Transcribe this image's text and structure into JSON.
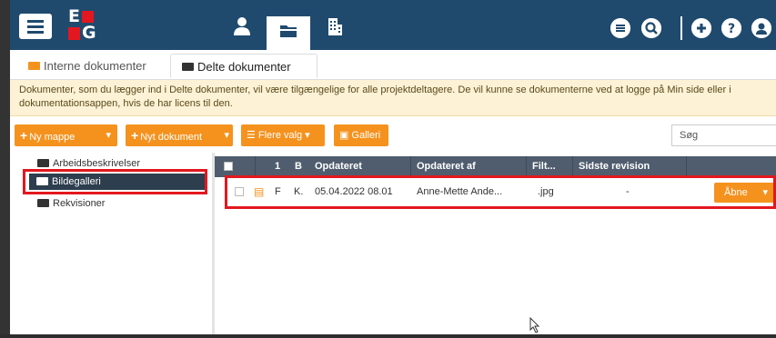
{
  "topbar": {
    "logo_letters": [
      "E",
      "G"
    ],
    "nav_icons": [
      "person-icon",
      "folder-icon",
      "building-icon"
    ],
    "right_icons": [
      "list-icon",
      "search-icon",
      "plus-icon",
      "help-icon",
      "user-icon"
    ],
    "colors": {
      "bar": "#1f4a6e",
      "accent": "#e3171f"
    }
  },
  "tabs": [
    {
      "label": "Interne dokumenter",
      "active": false
    },
    {
      "label": "Delte dokumenter",
      "active": true
    }
  ],
  "notice": {
    "text": "Dokumenter, som du lægger ind i Delte dokumenter, vil være tilgængelige for alle projektdeltagere. De vil kunne se dokumenterne ved at logge på Min side eller i dokumentationsappen, hvis de har licens til den."
  },
  "toolbar": {
    "new_folder": "Ny mappe",
    "new_document": "Nyt dokument",
    "more": "Flere valg",
    "gallery": "Galleri",
    "search_placeholder": "Søg"
  },
  "tree": {
    "items": [
      "Arbeidsbeskrivelser",
      "Bildegalleri",
      "Rekvisioner"
    ],
    "selected": "Bildegalleri"
  },
  "grid": {
    "columns": [
      "1",
      "B",
      "Opdateret",
      "Opdateret af",
      "Filt...",
      "Sidste revision"
    ],
    "rows": [
      {
        "col1": "F",
        "col2": "K.",
        "updated": "05.04.2022 08.01",
        "updated_by": "Anne-Mette Ande...",
        "filetype": ".jpg",
        "last_revision": "-",
        "action": "Åbne"
      }
    ]
  }
}
